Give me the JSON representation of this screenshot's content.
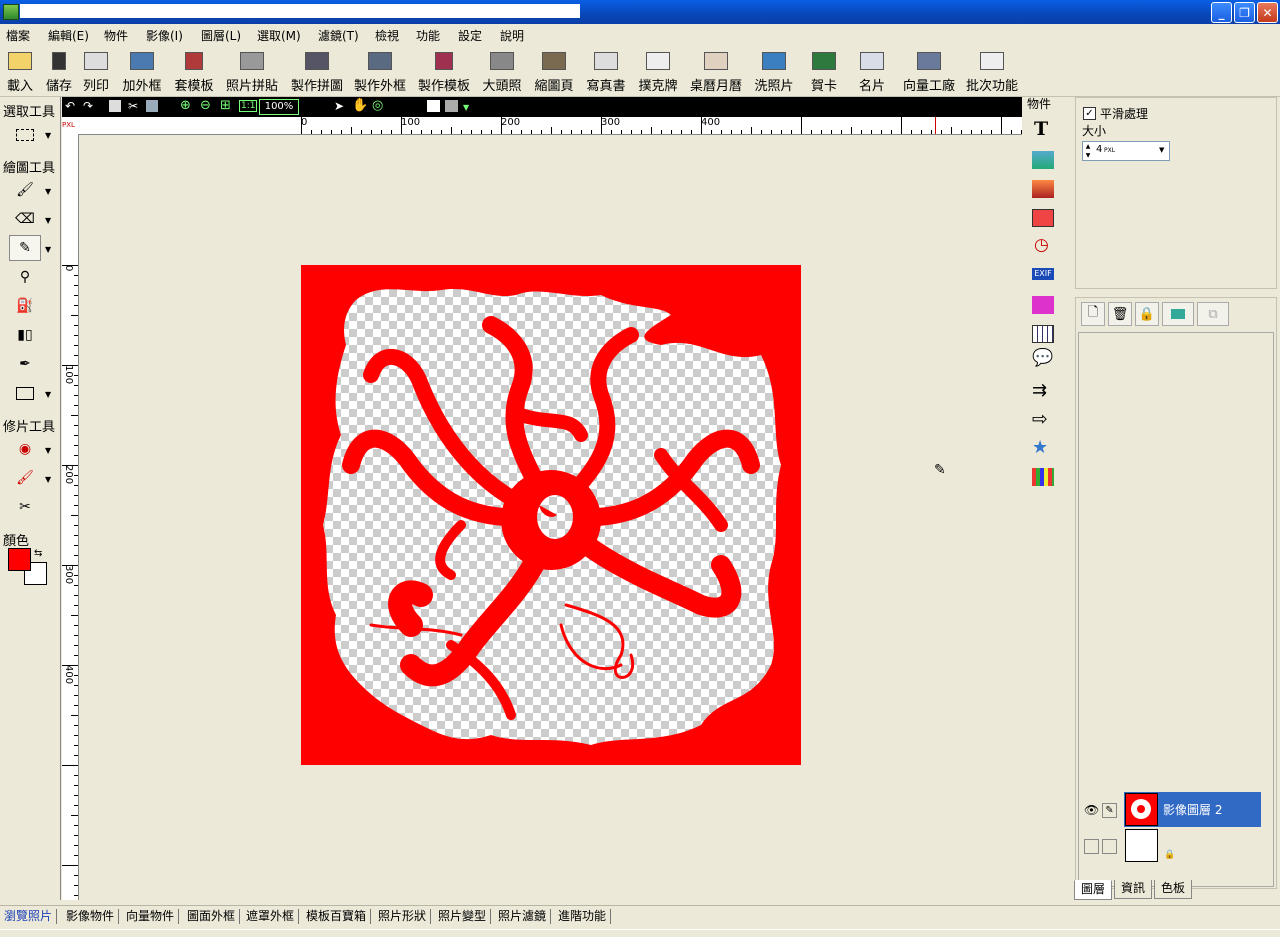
{
  "menu": [
    "檔案",
    "編輯(E)",
    "物件",
    "影像(I)",
    "圖層(L)",
    "選取(M)",
    "濾鏡(T)",
    "檢視",
    "功能",
    "設定",
    "說明"
  ],
  "toolbar": [
    {
      "label": "載入",
      "icon": "open-folder-icon"
    },
    {
      "label": "儲存",
      "icon": "save-disk-icon"
    },
    {
      "label": "列印",
      "icon": "printer-icon"
    },
    {
      "label": "加外框",
      "icon": "frame-icon"
    },
    {
      "label": "套模板",
      "icon": "template-icon"
    },
    {
      "label": "照片拼貼",
      "icon": "collage-icon"
    },
    {
      "label": "製作拼圖",
      "icon": "puzzle-icon"
    },
    {
      "label": "製作外框",
      "icon": "make-frame-icon"
    },
    {
      "label": "製作模板",
      "icon": "make-template-icon"
    },
    {
      "label": "大頭照",
      "icon": "id-photo-icon"
    },
    {
      "label": "縮圖頁",
      "icon": "thumbnail-page-icon"
    },
    {
      "label": "寫真書",
      "icon": "photo-book-icon"
    },
    {
      "label": "撲克牌",
      "icon": "playing-cards-icon"
    },
    {
      "label": "桌曆月曆",
      "icon": "calendar-icon"
    },
    {
      "label": "洗照片",
      "icon": "print-photo-icon"
    },
    {
      "label": "賀卡",
      "icon": "greeting-card-icon"
    },
    {
      "label": "名片",
      "icon": "business-card-icon"
    },
    {
      "label": "向量工廠",
      "icon": "vector-factory-icon"
    },
    {
      "label": "批次功能",
      "icon": "batch-icon"
    }
  ],
  "left_panel": {
    "select_tools": "選取工具",
    "draw_tools": "繪圖工具",
    "retouch_tools": "修片工具",
    "color": "顏色",
    "fg_color": "#ff0000",
    "bg_color": "#ffffff"
  },
  "canvas": {
    "zoom": "100%",
    "unit": "PXL",
    "hruler": [
      "0",
      "100",
      "200",
      "300",
      "400"
    ],
    "vruler": [
      "0",
      "100",
      "200",
      "300",
      "400"
    ]
  },
  "objects_title": "物件",
  "props": {
    "smooth_label": "平滑處理",
    "size_label": "大小",
    "size_value": "4",
    "size_unit": "PXL"
  },
  "layers": [
    {
      "name": "影像圖層 2"
    }
  ],
  "panel_tabs": [
    "圖層",
    "資訊",
    "色板"
  ],
  "bottom_tabs": [
    "瀏覽照片",
    "影像物件",
    "向量物件",
    "圖面外框",
    "遮罩外框",
    "模板百寶箱",
    "照片形狀",
    "照片變型",
    "照片濾鏡",
    "進階功能"
  ]
}
